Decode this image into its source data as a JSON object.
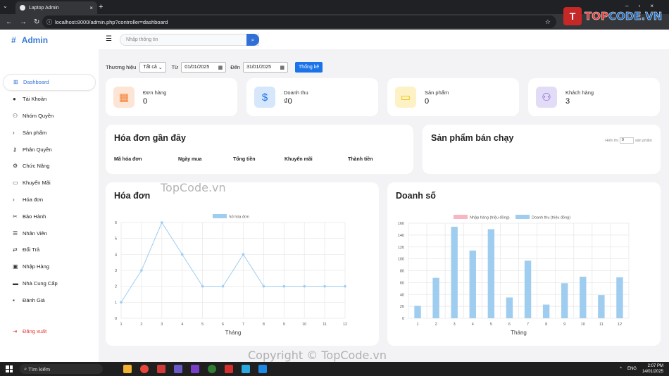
{
  "browser": {
    "tab_title": "Laptop Admin",
    "url": "localhost:8000/admin.php?controller=dashboard"
  },
  "brand_logo": {
    "part1": "TOP",
    "part2": "CODE.VN"
  },
  "sidebar": {
    "title": "Admin",
    "items": [
      {
        "label": "Dashboard",
        "icon": "grid-icon"
      },
      {
        "label": "Tài Khoản",
        "icon": "user-icon"
      },
      {
        "label": "Nhóm Quyền",
        "icon": "users-icon"
      },
      {
        "label": "Sản phẩm",
        "icon": "chevron-right-icon"
      },
      {
        "label": "Phân Quyền",
        "icon": "key-icon"
      },
      {
        "label": "Chức Năng",
        "icon": "gears-icon"
      },
      {
        "label": "Khuyến Mãi",
        "icon": "ticket-icon"
      },
      {
        "label": "Hóa đơn",
        "icon": "chevron-right-icon"
      },
      {
        "label": "Bảo Hành",
        "icon": "tools-icon"
      },
      {
        "label": "Nhân Viên",
        "icon": "id-card-icon"
      },
      {
        "label": "Đổi Trả",
        "icon": "exchange-icon"
      },
      {
        "label": "Nhập Hàng",
        "icon": "box-icon"
      },
      {
        "label": "Nhà Cung Cấp",
        "icon": "truck-icon"
      },
      {
        "label": "Đánh Giá",
        "icon": "comment-icon"
      }
    ],
    "logout": "Đăng xuất"
  },
  "topbar": {
    "search_placeholder": "Nhập thông tin"
  },
  "filter": {
    "brand_label": "Thương hiệu",
    "brand_value": "Tất cả",
    "from_label": "Từ",
    "from_value": "01/01/2025",
    "to_label": "Đến",
    "to_value": "31/01/2025",
    "button": "Thống kê"
  },
  "stats": [
    {
      "label": "Đơn hàng",
      "value": "0",
      "icon": "calendar-check-icon",
      "color": "#f5823b",
      "bg": "#fde5d5"
    },
    {
      "label": "Doanh thu",
      "value": "₫0",
      "icon": "dollar-icon",
      "color": "#1a73e8",
      "bg": "#d6e6fb"
    },
    {
      "label": "Sản phẩm",
      "value": "0",
      "icon": "laptop-icon",
      "color": "#f2c100",
      "bg": "#fdf1c6"
    },
    {
      "label": "Khách hàng",
      "value": "3",
      "icon": "users-icon",
      "color": "#7b5cd6",
      "bg": "#e3dcf7"
    }
  ],
  "recent_orders": {
    "title": "Hóa đơn gần đây",
    "columns": [
      "Mã hóa đơn",
      "Ngày mua",
      "Tổng tiền",
      "Khuyến mãi",
      "Thành tiền"
    ]
  },
  "best_sellers": {
    "title": "Sản phẩm bán chạy",
    "show_label": "Hiển thị",
    "show_value": "0",
    "unit_label": "sản phẩm"
  },
  "watermarks": {
    "top": "TopCode.vn",
    "bottom": "Copyright © TopCode.vn"
  },
  "chart_data": [
    {
      "type": "line",
      "title": "Hóa đơn",
      "xlabel": "Tháng",
      "ylabel": "",
      "x": [
        1,
        2,
        3,
        4,
        5,
        6,
        7,
        8,
        9,
        10,
        11,
        12
      ],
      "series": [
        {
          "name": "Số hóa đơn",
          "values": [
            1,
            3,
            6,
            4,
            2,
            2,
            4,
            2,
            2,
            2,
            2,
            2
          ],
          "color": "#9fcdf0"
        }
      ],
      "ylim": [
        0,
        6
      ],
      "yticks": [
        0,
        1,
        2,
        3,
        4,
        5,
        6
      ],
      "legend": "top",
      "grid": true
    },
    {
      "type": "bar",
      "title": "Doanh số",
      "xlabel": "Tháng",
      "ylabel": "",
      "categories": [
        "1",
        "2",
        "3",
        "4",
        "5",
        "6",
        "7",
        "8",
        "9",
        "10",
        "11",
        "12"
      ],
      "series": [
        {
          "name": "Nhập hàng (triệu đồng)",
          "values": [
            0,
            0,
            0,
            0,
            0,
            0,
            0,
            0,
            0,
            0,
            0,
            0
          ],
          "color": "#f7b6c2"
        },
        {
          "name": "Doanh thu (triệu đồng)",
          "values": [
            21,
            68,
            154,
            114,
            150,
            35,
            97,
            23,
            59,
            70,
            39,
            69
          ],
          "color": "#9fcdf0"
        }
      ],
      "ylim": [
        0,
        160
      ],
      "yticks": [
        0,
        20,
        40,
        60,
        80,
        100,
        120,
        140,
        160
      ],
      "legend": "top",
      "grid": true
    }
  ],
  "taskbar": {
    "search": "Tìm kiếm",
    "lang": "ENG",
    "time": "2:07 PM",
    "date": "14/01/2025"
  }
}
